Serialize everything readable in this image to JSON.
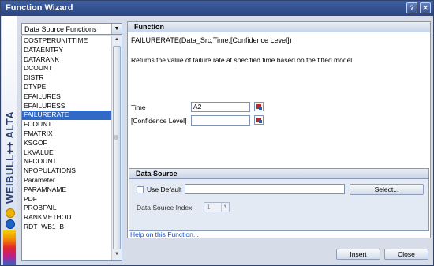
{
  "window": {
    "title": "Function Wizard"
  },
  "titlebar_buttons": {
    "help": "?",
    "close": "✕"
  },
  "brand": {
    "text": "WEIBULL++ ALTA"
  },
  "category_combo": {
    "selected": "Data Source Functions"
  },
  "function_list": [
    "COSTPERUNITTIME",
    "DATAENTRY",
    "DATARANK",
    "DCOUNT",
    "DISTR",
    "DTYPE",
    "EFAILURES",
    "EFAILURESS",
    "FAILURERATE",
    "FCOUNT",
    "FMATRIX",
    "KSGOF",
    "LKVALUE",
    "NFCOUNT",
    "NPOPULATIONS",
    "Parameter",
    "PARAMNAME",
    "PDF",
    "PROBFAIL",
    "RANKMETHOD",
    "RDT_WB1_B"
  ],
  "selected_function": "FAILURERATE",
  "function_panel": {
    "header": "Function",
    "signature": "FAILURERATE(Data_Src,Time,[Confidence Level])",
    "description": "Returns the value of failure rate at specified time based on the fitted model.",
    "args": [
      {
        "label": "Time",
        "value": "A2"
      },
      {
        "label": "[Confidence Level]",
        "value": ""
      }
    ]
  },
  "data_source": {
    "header": "Data Source",
    "use_default_label": "Use Default",
    "use_default_checked": false,
    "field_value": "",
    "select_button": "Select...",
    "index_label": "Data Source Index",
    "index_value": "1"
  },
  "help_link": "Help on this Function...",
  "buttons": {
    "insert": "Insert",
    "close": "Close"
  }
}
